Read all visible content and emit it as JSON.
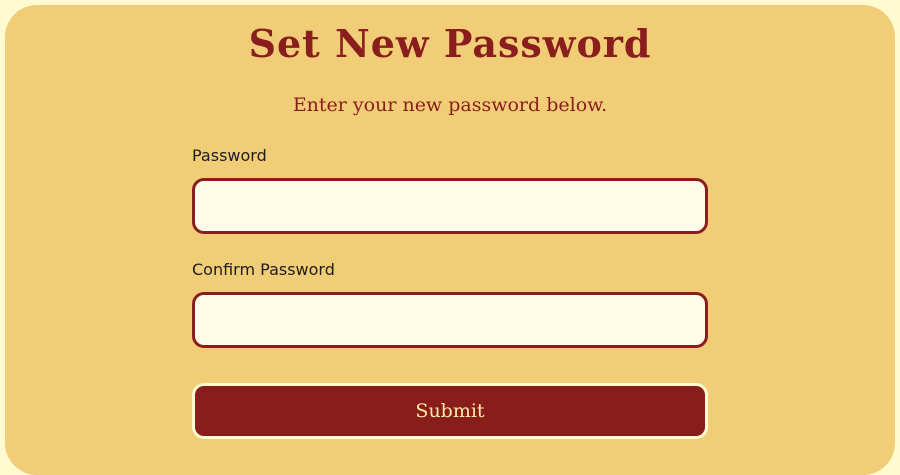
{
  "form": {
    "title": "Set New Password",
    "subtitle": "Enter your new password below.",
    "password_label": "Password",
    "password_value": "",
    "confirm_label": "Confirm Password",
    "confirm_value": "",
    "submit_label": "Submit"
  },
  "colors": {
    "page_background": "#fffbd0",
    "card_background": "#f0cd76",
    "accent": "#8a1d1d",
    "button_text": "#ffe9a6",
    "field_background": "#fffde8"
  }
}
